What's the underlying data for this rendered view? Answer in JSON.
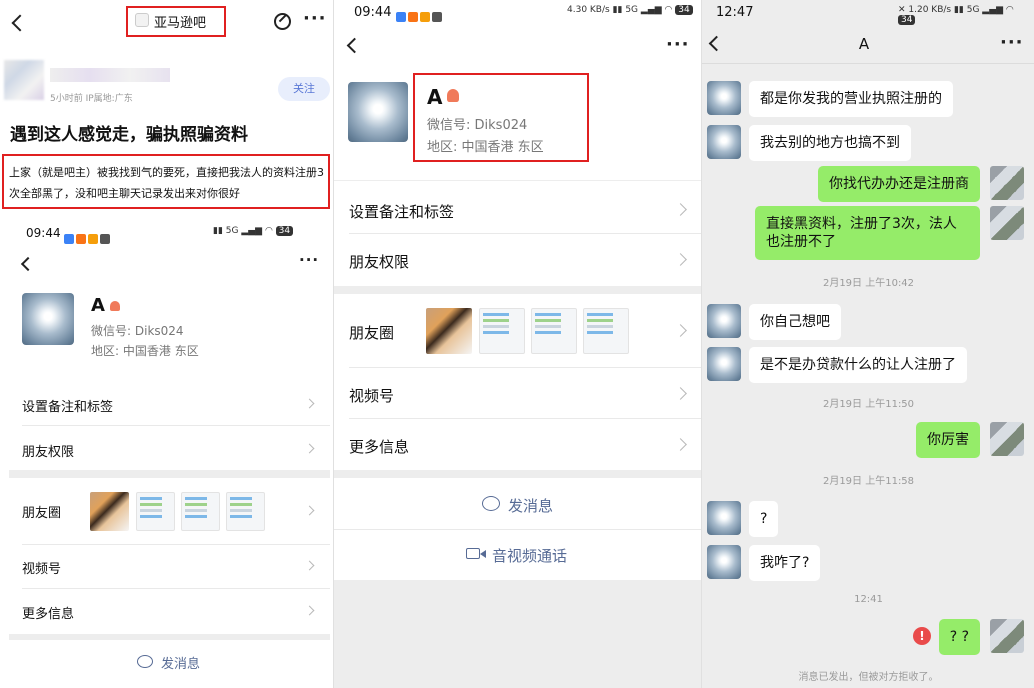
{
  "post": {
    "forum_name": "亚马逊吧",
    "meta": "5小时前   IP属地:广东",
    "follow_label": "关注",
    "title": "遇到这人感觉走，骗执照骗资料",
    "body": "上家（就是吧主）被我找到气的要死，直接把我法人的资料注册3次全部黑了，没和吧主聊天记录发出来对你很好"
  },
  "contact": {
    "status_time": "09:44",
    "name": "A",
    "wechat_id_label": "微信号:",
    "wechat_id": "Diks024",
    "region_label": "地区:",
    "region": "中国香港  东区",
    "menu": {
      "remark": "设置备注和标签",
      "permissions": "朋友权限",
      "moments": "朋友圈",
      "channels": "视频号",
      "more": "更多信息"
    },
    "send_message": "发消息",
    "av_call": "音视频通话"
  },
  "chat": {
    "status_time": "12:47",
    "title": "A",
    "messages": [
      {
        "side": "in",
        "text": "都是你发我的营业执照注册的"
      },
      {
        "side": "in",
        "text": "我去别的地方也搞不到"
      },
      {
        "side": "out",
        "text": "你找代办办还是注册商"
      },
      {
        "side": "out",
        "text": "直接黑资料，注册了3次，法人也注册不了"
      },
      {
        "side": "time",
        "text": "2月19日 上午10:42"
      },
      {
        "side": "in",
        "text": "你自己想吧"
      },
      {
        "side": "in",
        "text": "是不是办贷款什么的让人注册了"
      },
      {
        "side": "time",
        "text": "2月19日 上午11:50"
      },
      {
        "side": "out",
        "text": "你厉害"
      },
      {
        "side": "time",
        "text": "2月19日 上午11:58"
      },
      {
        "side": "in",
        "text": "?"
      },
      {
        "side": "in",
        "text": "我咋了?"
      },
      {
        "side": "time",
        "text": "12:41"
      },
      {
        "side": "out",
        "text": "? ?"
      }
    ],
    "rejected_notice": "消息已发出，但被对方拒收了。"
  },
  "status_bar": {
    "speed_p2": "4.30 KB/s",
    "speed_p3": "1.20 KB/s",
    "battery": "34"
  },
  "colors": {
    "highlight_border": "#e02020",
    "wechat_green_bubble": "#95ec69",
    "follow_button_bg": "#e8eefc",
    "follow_button_text": "#5a78d6"
  },
  "icons": [
    "back-arrow-icon",
    "more-dots-icon",
    "edit-icon",
    "gender-icon",
    "chevron-right-icon",
    "chat-bubble-icon",
    "video-call-icon",
    "error-icon"
  ]
}
